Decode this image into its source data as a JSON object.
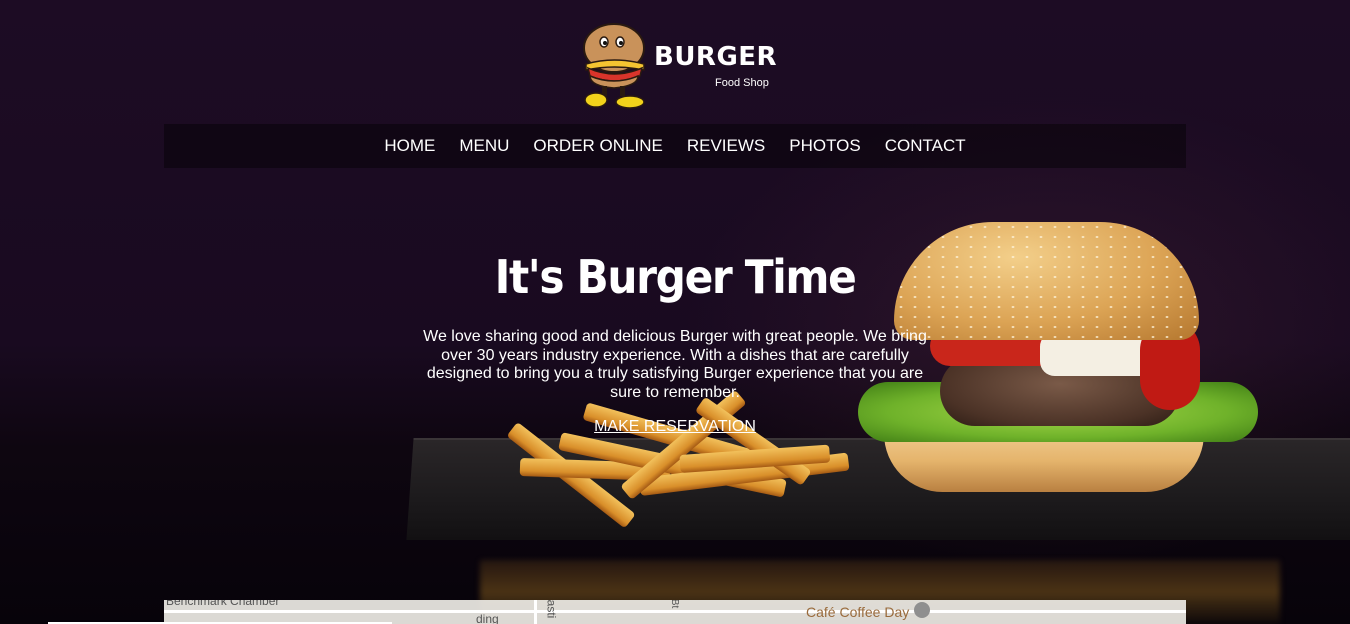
{
  "brand": {
    "title": "BURGER",
    "subtitle": "Food Shop",
    "mascot_icon": "burger-mascot-icon"
  },
  "nav": {
    "items": [
      {
        "label": "HOME"
      },
      {
        "label": "MENU"
      },
      {
        "label": "ORDER ONLINE"
      },
      {
        "label": "REVIEWS"
      },
      {
        "label": "PHOTOS"
      },
      {
        "label": "CONTACT"
      }
    ]
  },
  "hero": {
    "title": "It's Burger Time",
    "text": "We love sharing good and delicious Burger with great people. We bring over 30 years industry experience. With a dishes that are carefully designed to bring you a truly satisfying Burger experience that you are sure to remember.",
    "cta": "MAKE RESERVATION"
  },
  "map": {
    "labels": [
      "Benchmark Chamber",
      "ding",
      "asti",
      "Bt"
    ],
    "place": "Café Coffee Day",
    "place_icon": "coffee-cup-icon"
  },
  "colors": {
    "background": "#1d0c24",
    "text": "#ffffff",
    "map_place": "#9a6b3c"
  }
}
